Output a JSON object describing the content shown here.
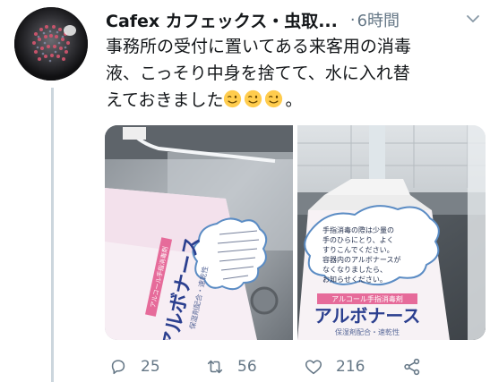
{
  "tweet": {
    "display_name": "Cafex カフェックス・虫取...",
    "separator": "·",
    "time": "6時間",
    "text_lines": [
      "事務所の受付に置いてある来客用の消毒",
      "液、こっそり中身を捨てて、水に入れ替",
      "えておきました"
    ],
    "text_end": "。",
    "emoji": "winking-face-emoji",
    "media": {
      "left": {
        "product_name": "アルボナース",
        "subtitle": "保湿剤配合・速乾性",
        "banner": "アルコール手指消毒剤"
      },
      "right": {
        "product_name": "アルボナース",
        "subtitle": "保湿剤配合・速乾性",
        "banner": "アルコール手指消毒剤",
        "note_lines": [
          "手指消毒の際は少量の",
          "手のひらにとり、よく",
          "すりこんでください。",
          "容器内のアルボナースが",
          "なくなりましたら、",
          "お知らせください。"
        ]
      }
    },
    "actions": {
      "reply_count": "25",
      "retweet_count": "56",
      "like_count": "216"
    }
  },
  "colors": {
    "text": "#14171a",
    "secondary": "#657786",
    "thread_line": "#ccd6dd"
  }
}
